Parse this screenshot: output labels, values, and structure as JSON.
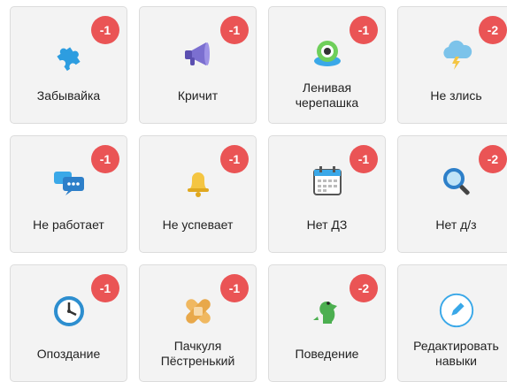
{
  "colors": {
    "card_bg": "#f3f3f3",
    "badge_bg": "#ea5455",
    "edit_accent": "#3aa8e8"
  },
  "skills": [
    {
      "label": "Забывайка",
      "points": "-1",
      "icon": "puzzle-icon"
    },
    {
      "label": "Кричит",
      "points": "-1",
      "icon": "megaphone-icon"
    },
    {
      "label": "Ленивая\nчерепашка",
      "points": "-1",
      "icon": "turtle-icon"
    },
    {
      "label": "Не злись",
      "points": "-2",
      "icon": "storm-cloud-icon"
    },
    {
      "label": "Не работает",
      "points": "-1",
      "icon": "chat-bubbles-icon"
    },
    {
      "label": "Не успевает",
      "points": "-1",
      "icon": "bell-icon"
    },
    {
      "label": "Нет ДЗ",
      "points": "-1",
      "icon": "calendar-icon"
    },
    {
      "label": "Нет д/з",
      "points": "-2",
      "icon": "magnifier-icon"
    },
    {
      "label": "Опоздание",
      "points": "-1",
      "icon": "clock-icon"
    },
    {
      "label": "Пачкуля\nПёстренький",
      "points": "-1",
      "icon": "bandage-icon"
    },
    {
      "label": "Поведение",
      "points": "-2",
      "icon": "dinosaur-icon"
    }
  ],
  "edit": {
    "label": "Редактировать\nнавыки",
    "icon": "pencil-icon"
  }
}
